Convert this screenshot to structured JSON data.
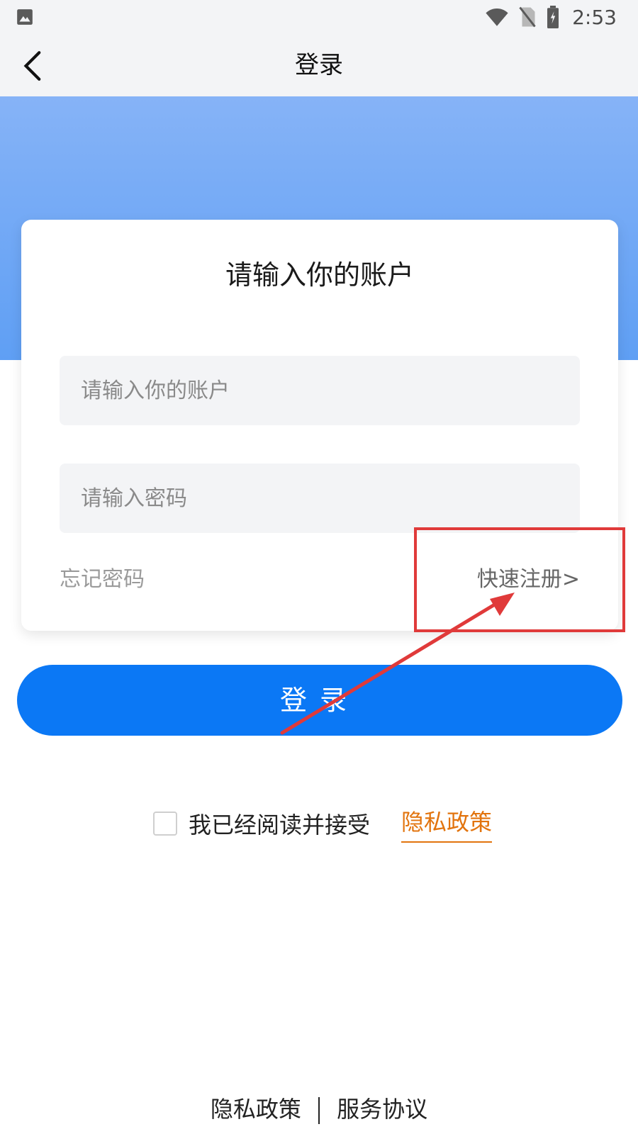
{
  "status_bar": {
    "time": "2:53",
    "left_icon": "gallery-icon",
    "right_icons": [
      "wifi-icon",
      "no-sim-icon",
      "battery-charging-icon"
    ]
  },
  "navbar": {
    "back_icon": "chevron-left-icon",
    "title": "登录"
  },
  "card": {
    "title": "请输入你的账户",
    "account_placeholder": "请输入你的账户",
    "password_placeholder": "请输入密码",
    "forgot_password": "忘记密码",
    "quick_register": "快速注册>"
  },
  "login_button": {
    "label": "登录"
  },
  "agreement": {
    "text": "我已经阅读并接受",
    "privacy_link": "隐私政策",
    "checked": false
  },
  "footer": {
    "privacy": "隐私政策",
    "service": "服务协议"
  },
  "colors": {
    "primary": "#0b78f5",
    "hero_top": "#86b3f7",
    "hero_bottom": "#5f9ff4",
    "link_orange": "#e2740e",
    "annotation_red": "#e03a3a"
  }
}
